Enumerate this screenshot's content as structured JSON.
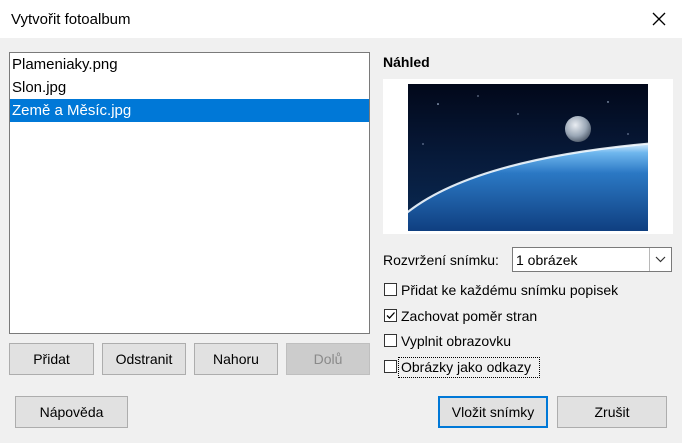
{
  "window": {
    "title": "Vytvořit fotoalbum"
  },
  "icons": {
    "close": "close-icon",
    "dropdown": "chevron-down-icon",
    "check": "check-icon"
  },
  "files": {
    "items": [
      {
        "label": "Plameniaky.png",
        "selected": false
      },
      {
        "label": "Slon.jpg",
        "selected": false
      },
      {
        "label": "Země a Měsíc.jpg",
        "selected": true
      }
    ]
  },
  "list_buttons": {
    "add": "Přidat",
    "remove": "Odstranit",
    "up": "Nahoru",
    "down": "Dolů"
  },
  "preview": {
    "heading": "Náhled"
  },
  "layout": {
    "label": "Rozvržení snímku:",
    "selected": "1 obrázek"
  },
  "options": {
    "caption": {
      "label": "Přidat ke každému snímku popisek",
      "checked": false
    },
    "aspect": {
      "label": "Zachovat poměr stran",
      "checked": true
    },
    "fill": {
      "label": "Vyplnit obrazovku",
      "checked": false
    },
    "links": {
      "label": "Obrázky jako odkazy",
      "checked": false
    }
  },
  "footer": {
    "help": "Nápověda",
    "insert": "Vložit snímky",
    "cancel": "Zrušit"
  },
  "colors": {
    "accent": "#0078d7",
    "background": "#f0f0f0"
  }
}
